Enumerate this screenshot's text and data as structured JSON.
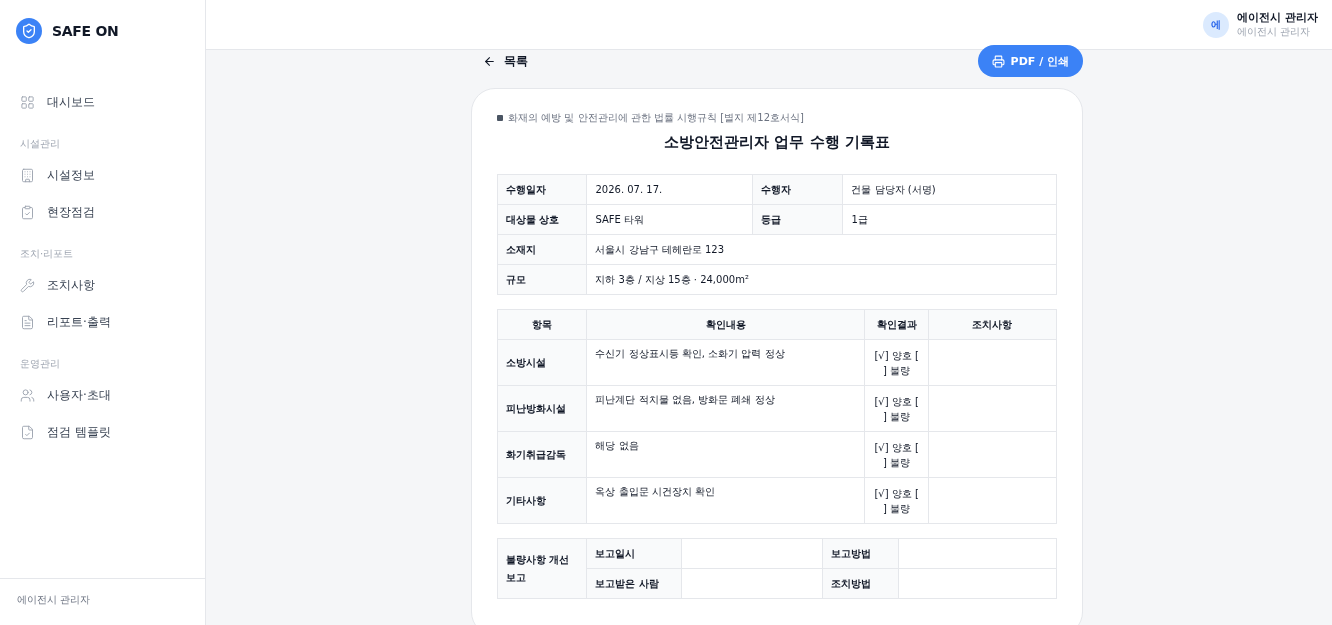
{
  "brand": {
    "name": "SAFE ON"
  },
  "sidebar": {
    "sections": [
      {
        "items": [
          {
            "label": "대시보드"
          }
        ]
      },
      {
        "heading": "시설관리",
        "items": [
          {
            "label": "시설정보"
          },
          {
            "label": "현장점검"
          }
        ]
      },
      {
        "heading": "조치·리포트",
        "items": [
          {
            "label": "조치사항"
          },
          {
            "label": "리포트·출력"
          }
        ]
      },
      {
        "heading": "운영관리",
        "items": [
          {
            "label": "사용자·초대"
          },
          {
            "label": "점검 템플릿"
          }
        ]
      }
    ],
    "footer": "에이전시 관리자"
  },
  "user": {
    "avatar": "에",
    "name": "에이전시 관리자",
    "role": "에이전시 관리자"
  },
  "back_link": "목록",
  "print_button": "PDF / 인쇄",
  "document": {
    "legal_ref": "화재의 예방 및 안전관리에 관한 법률 시행규칙 [별지 제12호서식]",
    "title": "소방안전관리자 업무 수행 기록표",
    "info_rows": [
      {
        "cells": [
          {
            "label": "수행일자",
            "value": "2026. 07. 17."
          },
          {
            "label": "수행자",
            "value": "건물 담당자 (서명)"
          }
        ]
      },
      {
        "cells": [
          {
            "label": "대상물 상호",
            "value": "SAFE 타워"
          },
          {
            "label": "등급",
            "value": "1급"
          }
        ]
      },
      {
        "cells": [
          {
            "label": "소재지",
            "value": "서울시 강남구 테헤란로 123"
          }
        ]
      },
      {
        "cells": [
          {
            "label": "규모",
            "value": "지하 3층 / 지상 15층 · 24,000m²"
          }
        ]
      }
    ],
    "check_table": {
      "columns": [
        "항목",
        "확인내용",
        "확인결과",
        "조치사항"
      ],
      "rows": [
        {
          "item": "소방시설",
          "content": "수신기 정상표시등 확인, 소화기 압력 정상",
          "result": "[√] 양호 [ ] 불량"
        },
        {
          "item": "피난방화시설",
          "content": "피난계단 적치물 없음, 방화문 폐쇄 정상",
          "result": "[√] 양호 [ ] 불량"
        },
        {
          "item": "화기취급감독",
          "content": "해당 없음",
          "result": "[√] 양호 [ ] 불량"
        },
        {
          "item": "기타사항",
          "content": "옥상 출입문 시건장치 확인",
          "result": "[√] 양호 [ ] 불량"
        }
      ]
    },
    "report_table": {
      "heading": "불량사항 개선보고",
      "rows": [
        [
          "보고일시",
          "보고방법"
        ],
        [
          "보고받은 사람",
          "조치방법"
        ]
      ]
    }
  }
}
